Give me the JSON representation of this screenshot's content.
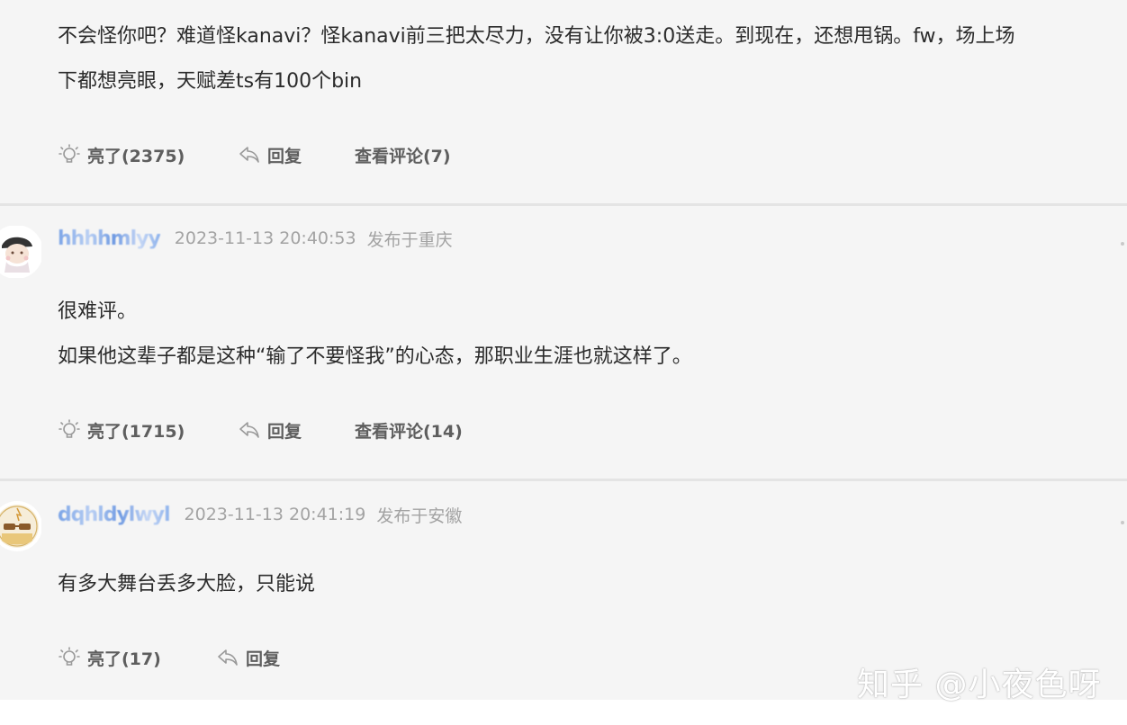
{
  "comments": [
    {
      "text_lines": [
        "不会怪你吧？难道怪kanavi？怪kanavi前三把太尽力，没有让你被3:0送走。到现在，还想甩锅。fw，场上场",
        "下都想亮眼，天赋差ts有100个bin"
      ],
      "like_label": "亮了(2375)",
      "reply_label": "回复",
      "view_label": "查看评论(7)",
      "avatar_icon": "avatar-peek-orange"
    },
    {
      "username": "hhhhmlyy",
      "timestamp": "2023-11-13 20:40:53",
      "location": "发布于重庆",
      "text_lines": [
        "很难评。",
        "如果他这辈子都是这种“输了不要怪我”的心态，那职业生涯也就这样了。"
      ],
      "like_label": "亮了(1715)",
      "reply_label": "回复",
      "view_label": "查看评论(14)",
      "avatar_icon": "anime-character-avatar"
    },
    {
      "username": "dqhldylwyl",
      "timestamp": "2023-11-13 20:41:19",
      "location": "发布于安徽",
      "text_lines": [
        "有多大舞台丢多大脸，只能说"
      ],
      "like_label": "亮了(17)",
      "reply_label": "回复",
      "avatar_icon": "sunglasses-face-avatar"
    }
  ],
  "icons": {
    "like": "lightbulb-icon",
    "reply": "reply-arrow-icon"
  },
  "watermark": "知乎 @小夜色呀",
  "colors": {
    "background": "#f5f5f5",
    "divider": "#e4e4e4",
    "text": "#2b2b2b",
    "meta": "#a3a3a3",
    "action": "#5e5e5e",
    "username": "#8fb5ee"
  }
}
